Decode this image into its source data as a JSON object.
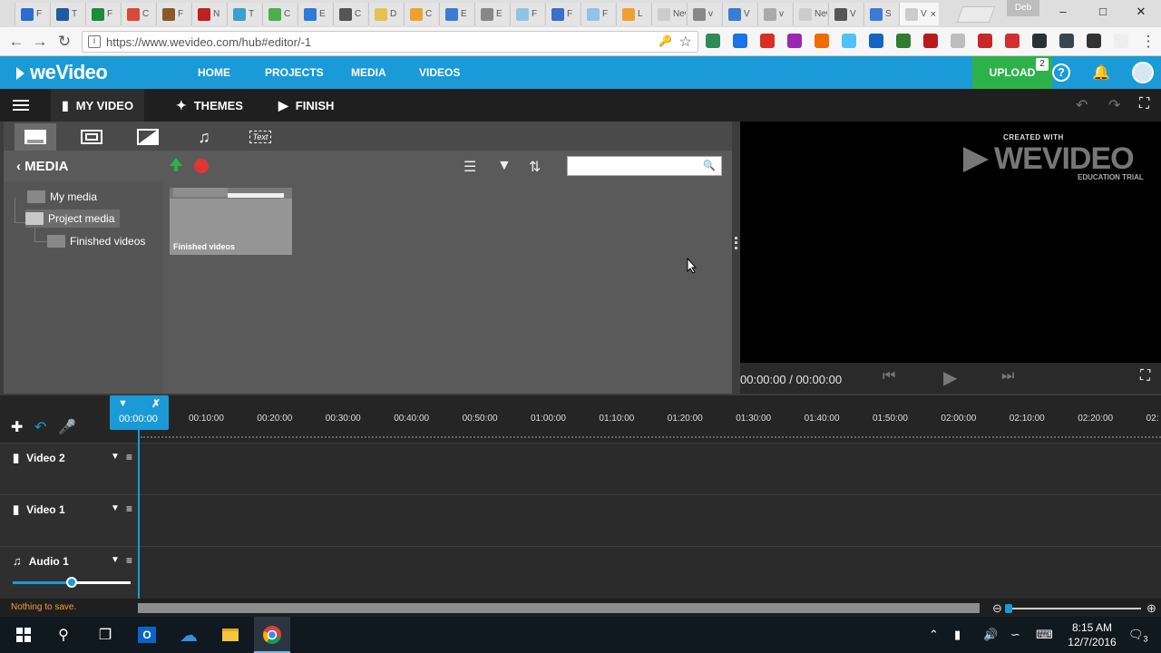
{
  "browser": {
    "tabs": [
      {
        "label": "F",
        "color": "#2b6cd1"
      },
      {
        "label": "T",
        "color": "#1e5aa0"
      },
      {
        "label": "F",
        "color": "#1e8a3c"
      },
      {
        "label": "C",
        "color": "#d84a3a"
      },
      {
        "label": "F",
        "color": "#8a5a2a"
      },
      {
        "label": "N",
        "color": "#c02020"
      },
      {
        "label": "T",
        "color": "#3aa0d0"
      },
      {
        "label": "C",
        "color": "#4caf50"
      },
      {
        "label": "E",
        "color": "#2c7bd6"
      },
      {
        "label": "C",
        "color": "#555555"
      },
      {
        "label": "D",
        "color": "#e8c050"
      },
      {
        "label": "C",
        "color": "#f0a030"
      },
      {
        "label": "E",
        "color": "#3a7bd5"
      },
      {
        "label": "E",
        "color": "#888888"
      },
      {
        "label": "F",
        "color": "#8fc3e8"
      },
      {
        "label": "F",
        "color": "#3a6fc9"
      },
      {
        "label": "F",
        "color": "#8fc3e8"
      },
      {
        "label": "L",
        "color": "#f0a030"
      },
      {
        "label": "New",
        "color": "#cccccc"
      },
      {
        "label": "v",
        "color": "#888888"
      },
      {
        "label": "V",
        "color": "#3a7bd5"
      },
      {
        "label": "v",
        "color": "#aaaaaa"
      },
      {
        "label": "New",
        "color": "#cccccc"
      },
      {
        "label": "V",
        "color": "#555555"
      },
      {
        "label": "S",
        "color": "#3a7bd5"
      },
      {
        "label": "V",
        "color": "#cccccc"
      }
    ],
    "profile_name": "Deb",
    "url": "https://www.wevideo.com/hub#editor/-1",
    "extensions": [
      "#2e8b57",
      "#1a73e8",
      "#d93025",
      "#9c27b0",
      "#ef6c00",
      "#4fc3f7",
      "#1565c0",
      "#2e7d32",
      "#b71c1c",
      "#bdbdbd",
      "#c62828",
      "#d32f2f",
      "#263238",
      "#37474f",
      "#333333",
      "#eeeeee"
    ]
  },
  "app": {
    "logo": "weVideo",
    "nav": [
      "HOME",
      "PROJECTS",
      "MEDIA",
      "VIDEOS"
    ],
    "upload_label": "UPLOAD",
    "upload_count": "2",
    "help_glyph": "?",
    "bell_glyph": "🔔"
  },
  "editor": {
    "tabs": [
      {
        "label": "MY VIDEO",
        "icon": "film-icon"
      },
      {
        "label": "THEMES",
        "icon": "wand-icon"
      },
      {
        "label": "FINISH",
        "icon": "finish-icon"
      }
    ],
    "media_tabs": [
      "media-icon",
      "transitions-icon",
      "color-icon",
      "music-icon",
      "text-icon"
    ],
    "media_tab_text_label": "Text",
    "media_title": "MEDIA",
    "search_placeholder": "",
    "tree": {
      "my_media": "My media",
      "project_media": "Project media",
      "finished_videos": "Finished videos"
    },
    "folders": [
      {
        "label": "Finished videos"
      }
    ],
    "preview": {
      "watermark_top": "CREATED WITH",
      "watermark_brand": "WEVIDEO",
      "watermark_sub": "EDUCATION TRIAL",
      "time": "00:00:00 / 00:00:00"
    },
    "timeline": {
      "playhead_time": "00:00:00",
      "ticks": [
        "00:10:00",
        "00:20:00",
        "00:30:00",
        "00:40:00",
        "00:50:00",
        "01:00:00",
        "01:10:00",
        "01:20:00",
        "01:30:00",
        "01:40:00",
        "01:50:00",
        "02:00:00",
        "02:10:00",
        "02:20:00",
        "02:"
      ],
      "tracks": [
        {
          "name": "Video 2",
          "type": "video"
        },
        {
          "name": "Video 1",
          "type": "video"
        },
        {
          "name": "Audio 1",
          "type": "audio"
        }
      ],
      "audio_volume": 0.5,
      "status": "Nothing to save."
    }
  },
  "taskbar": {
    "time": "8:15 AM",
    "date": "12/7/2016",
    "notifications": "3"
  }
}
